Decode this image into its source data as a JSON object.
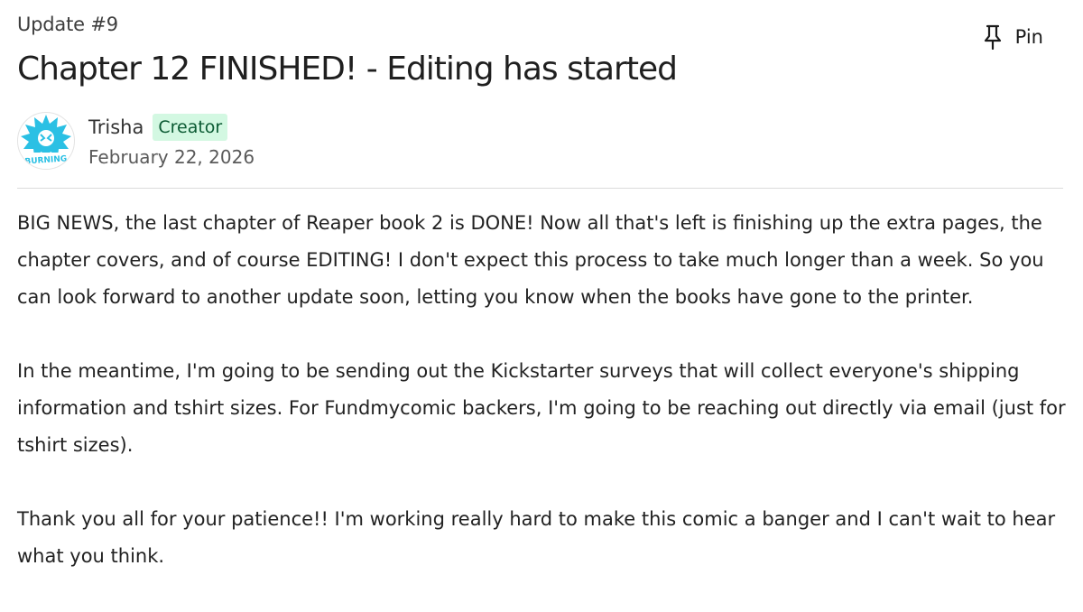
{
  "post": {
    "update_label": "Update #9",
    "title": "Chapter 12 FINISHED! - Editing has started",
    "pin_label": "Pin",
    "pin_icon": "pin-icon"
  },
  "author": {
    "name": "Trisha",
    "badge": "Creator",
    "date": "February 22, 2026",
    "avatar_text": "BURNING",
    "avatar_color": "#2bc0e4"
  },
  "body": {
    "paragraphs": [
      "BIG NEWS, the last chapter of Reaper book 2 is DONE! Now all that's left is finishing up the extra pages, the chapter covers, and of course EDITING! I don't expect this process to take much longer than a week. So you can look forward to another update soon, letting you know when the books have gone to the printer.",
      "In the meantime, I'm going to be sending out the Kickstarter surveys that will collect everyone's shipping information and tshirt sizes. For Fundmycomic backers, I'm going to be reaching out directly via email (just for tshirt sizes).",
      "Thank you all for your patience!! I'm working really hard to make this comic a banger and I can't wait to hear what you think."
    ]
  },
  "colors": {
    "badge_bg": "#d3f8e2",
    "badge_text": "#0b5a33",
    "divider": "#dcdcdc"
  }
}
